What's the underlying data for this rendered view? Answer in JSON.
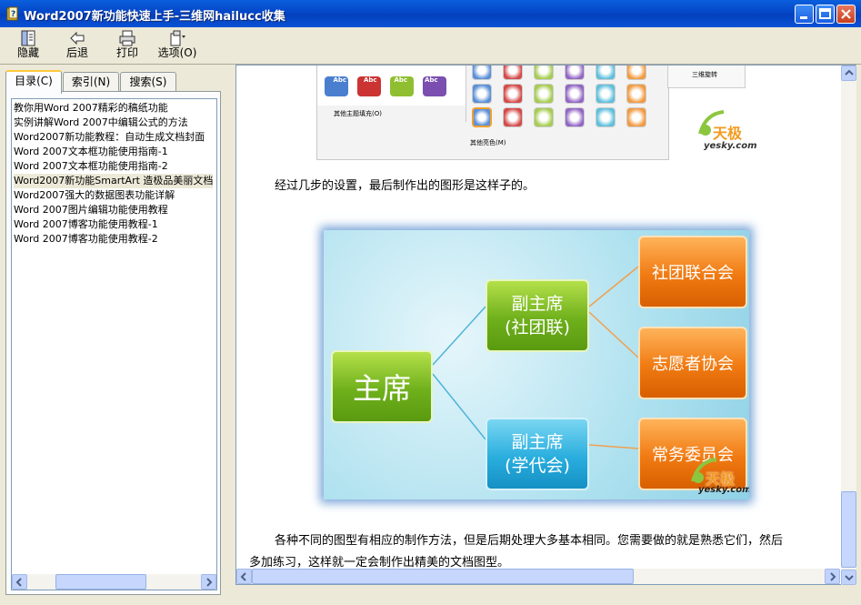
{
  "window": {
    "title": "Word2007新功能快速上手-三维网hailucc收集"
  },
  "toolbar": {
    "hide_label": "隐藏",
    "back_label": "后退",
    "print_label": "打印",
    "options_label": "选项(O)"
  },
  "tabs": [
    {
      "label": "目录(C)"
    },
    {
      "label": "索引(N)"
    },
    {
      "label": "搜索(S)"
    }
  ],
  "toc": {
    "items": [
      "教你用Word 2007精彩的稿纸功能",
      "实例讲解Word 2007中编辑公式的方法",
      "Word2007新功能教程：自动生成文档封面",
      "Word 2007文本框功能使用指南-1",
      "Word 2007文本框功能使用指南-2",
      "Word2007新功能SmartArt 造极品美丽文档",
      "Word2007强大的数据图表功能详解",
      "Word 2007图片编辑功能使用教程",
      "Word 2007博客功能使用教程-1",
      "Word 2007博客功能使用教程-2"
    ],
    "selected_index": 5
  },
  "screenshot": {
    "more_theme_fill": "其他主题填充(O)",
    "more_colors": "其他亮色(M)",
    "rotate_3d": "三维旋转",
    "abc": "Abc"
  },
  "article": {
    "para1": "经过几步的设置，最后制作出的图形是这样子的。",
    "para2_line1": "各种不同的图型有相应的制作方法，但是后期处理大多基本相同。您需要做的就是熟悉它们，然后",
    "para2_line2": "多加练习，这样就一定会制作出精美的文档图型。"
  },
  "diagram": {
    "root": "主席",
    "vice1_line1": "副主席",
    "vice1_line2": "(社团联)",
    "vice2_line1": "副主席",
    "vice2_line2": "(学代会)",
    "leaf1": "社团联合会",
    "leaf2": "志愿者协会",
    "leaf3": "常务委员会"
  },
  "watermark": {
    "brand_cn": "天极",
    "brand_url": "yesky.com"
  }
}
